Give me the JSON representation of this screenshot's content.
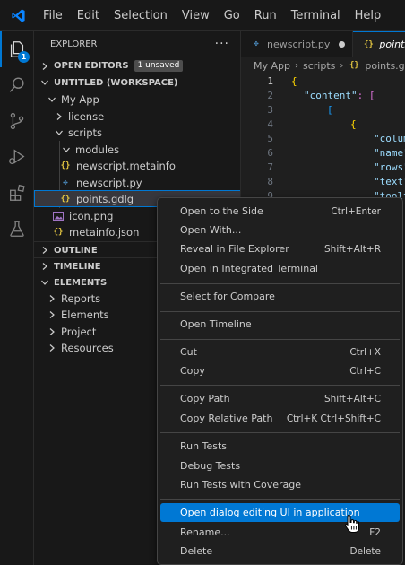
{
  "menubar": {
    "items": [
      "File",
      "Edit",
      "Selection",
      "View",
      "Go",
      "Run",
      "Terminal",
      "Help"
    ]
  },
  "activity_bar": {
    "explorer_badge": "1"
  },
  "sidebar": {
    "title": "EXPLORER",
    "more_label": "···",
    "open_editors": {
      "label": "OPEN EDITORS",
      "badge": "1 unsaved"
    },
    "workspace": {
      "label": "UNTITLED (WORKSPACE)"
    },
    "tree": {
      "my_app": "My App",
      "license": "license",
      "scripts": "scripts",
      "modules": "modules",
      "newscript_meta": "newscript.metainfo",
      "newscript_py": "newscript.py",
      "points": "points.gdlg",
      "icon": "icon.png",
      "metainfo": "metainfo.json"
    },
    "outline": "OUTLINE",
    "timeline": "TIMELINE",
    "elements": {
      "label": "ELEMENTS",
      "items": [
        "Reports",
        "Elements",
        "Project",
        "Resources"
      ]
    }
  },
  "editor": {
    "tabs": [
      {
        "label": "newscript.py",
        "dirty": true
      },
      {
        "label": "points.gdlg",
        "active": true
      }
    ],
    "breadcrumb": [
      "My App",
      "scripts",
      "points.gdlg"
    ],
    "lines": [
      {
        "num": "1",
        "text": "{"
      },
      {
        "num": "2",
        "key": "\"content\"",
        "rest": ": ["
      },
      {
        "num": "3",
        "text": "["
      },
      {
        "num": "4",
        "text": "{"
      },
      {
        "num": "5",
        "key": "\"colum"
      },
      {
        "num": "6",
        "key": "\"name\""
      },
      {
        "num": "7",
        "key": "\"rows\""
      },
      {
        "num": "8",
        "key": "\"text\""
      },
      {
        "num": "9",
        "key": "\"toolt"
      }
    ]
  },
  "context_menu": {
    "open_to_side": {
      "label": "Open to the Side",
      "shortcut": "Ctrl+Enter"
    },
    "open_with": {
      "label": "Open With..."
    },
    "reveal": {
      "label": "Reveal in File Explorer",
      "shortcut": "Shift+Alt+R"
    },
    "open_terminal": {
      "label": "Open in Integrated Terminal"
    },
    "select_compare": {
      "label": "Select for Compare"
    },
    "open_timeline": {
      "label": "Open Timeline"
    },
    "cut": {
      "label": "Cut",
      "shortcut": "Ctrl+X"
    },
    "copy": {
      "label": "Copy",
      "shortcut": "Ctrl+C"
    },
    "copy_path": {
      "label": "Copy Path",
      "shortcut": "Shift+Alt+C"
    },
    "copy_rel_path": {
      "label": "Copy Relative Path",
      "shortcut": "Ctrl+K Ctrl+Shift+C"
    },
    "run_tests": {
      "label": "Run Tests"
    },
    "debug_tests": {
      "label": "Debug Tests"
    },
    "run_tests_cov": {
      "label": "Run Tests with Coverage"
    },
    "open_dialog_ui": {
      "label": "Open dialog editing UI in application"
    },
    "rename": {
      "label": "Rename...",
      "shortcut": "F2"
    },
    "delete": {
      "label": "Delete",
      "shortcut": "Delete"
    }
  },
  "colors": {
    "accent": "#0078d4",
    "json_icon": "#e2c541",
    "python_icon": "#4b8bbe"
  }
}
